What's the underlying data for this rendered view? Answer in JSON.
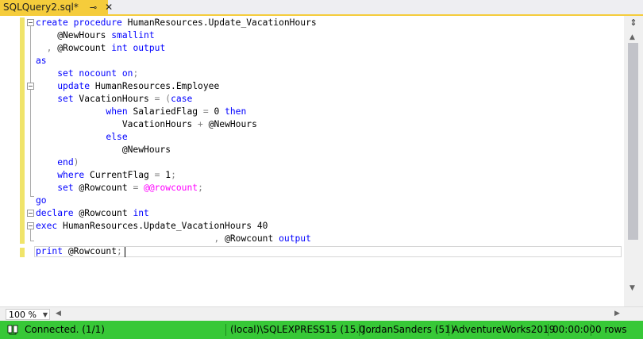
{
  "tab": {
    "title": "SQLQuery2.sql*",
    "pin": "⊸",
    "close": "✕"
  },
  "code_lines": [
    [
      {
        "t": "create procedure",
        "c": "kw"
      },
      {
        "t": " HumanResources.Update_VacationHours",
        "c": ""
      }
    ],
    [
      {
        "t": "    @NewHours ",
        "c": ""
      },
      {
        "t": "smallint",
        "c": "kw"
      }
    ],
    [
      {
        "t": "  ",
        "c": ""
      },
      {
        "t": ",",
        "c": "gr"
      },
      {
        "t": " @Rowcount ",
        "c": ""
      },
      {
        "t": "int output",
        "c": "kw"
      }
    ],
    [
      {
        "t": "as",
        "c": "kw"
      }
    ],
    [
      {
        "t": "    ",
        "c": ""
      },
      {
        "t": "set nocount on",
        "c": "kw"
      },
      {
        "t": ";",
        "c": "gr"
      }
    ],
    [
      {
        "t": "    ",
        "c": ""
      },
      {
        "t": "update",
        "c": "kw"
      },
      {
        "t": " HumanResources.Employee",
        "c": ""
      }
    ],
    [
      {
        "t": "    ",
        "c": ""
      },
      {
        "t": "set",
        "c": "kw"
      },
      {
        "t": " VacationHours ",
        "c": ""
      },
      {
        "t": "=",
        "c": "gr"
      },
      {
        "t": " ",
        "c": ""
      },
      {
        "t": "(",
        "c": "gr"
      },
      {
        "t": "case",
        "c": "kw"
      }
    ],
    [
      {
        "t": "             ",
        "c": ""
      },
      {
        "t": "when",
        "c": "kw"
      },
      {
        "t": " SalariedFlag ",
        "c": ""
      },
      {
        "t": "=",
        "c": "gr"
      },
      {
        "t": " 0 ",
        "c": ""
      },
      {
        "t": "then",
        "c": "kw"
      }
    ],
    [
      {
        "t": "                VacationHours ",
        "c": ""
      },
      {
        "t": "+",
        "c": "gr"
      },
      {
        "t": " @NewHours",
        "c": ""
      }
    ],
    [
      {
        "t": "             ",
        "c": ""
      },
      {
        "t": "else",
        "c": "kw"
      }
    ],
    [
      {
        "t": "                @NewHours",
        "c": ""
      }
    ],
    [
      {
        "t": "    ",
        "c": ""
      },
      {
        "t": "end",
        "c": "kw"
      },
      {
        "t": ")",
        "c": "gr"
      }
    ],
    [
      {
        "t": "    ",
        "c": ""
      },
      {
        "t": "where",
        "c": "kw"
      },
      {
        "t": " CurrentFlag ",
        "c": ""
      },
      {
        "t": "=",
        "c": "gr"
      },
      {
        "t": " 1",
        "c": ""
      },
      {
        "t": ";",
        "c": "gr"
      }
    ],
    [
      {
        "t": "    ",
        "c": ""
      },
      {
        "t": "set",
        "c": "kw"
      },
      {
        "t": " @Rowcount ",
        "c": ""
      },
      {
        "t": "=",
        "c": "gr"
      },
      {
        "t": " ",
        "c": ""
      },
      {
        "t": "@@rowcount",
        "c": "mg"
      },
      {
        "t": ";",
        "c": "gr"
      }
    ],
    [
      {
        "t": "go",
        "c": "kw"
      }
    ],
    [
      {
        "t": "declare",
        "c": "kw"
      },
      {
        "t": " @Rowcount ",
        "c": ""
      },
      {
        "t": "int",
        "c": "kw"
      }
    ],
    [
      {
        "t": "exec",
        "c": "kw"
      },
      {
        "t": " HumanResources.Update_VacationHours 40",
        "c": ""
      }
    ],
    [
      {
        "t": "                                 ",
        "c": ""
      },
      {
        "t": ",",
        "c": "gr"
      },
      {
        "t": " @Rowcount ",
        "c": ""
      },
      {
        "t": "output",
        "c": "kw"
      }
    ],
    [
      {
        "t": "print",
        "c": "kw"
      },
      {
        "t": " @Rowcount",
        "c": ""
      },
      {
        "t": ";",
        "c": "gr"
      }
    ]
  ],
  "zoom": {
    "value": "100 %"
  },
  "status": {
    "connection": "Connected. (1/1)",
    "server": "(local)\\SQLEXPRESS15 (15.0 ...",
    "user": "JordanSanders (51)",
    "database": "AdventureWorks2019",
    "time": "00:00:00",
    "rows": "0 rows"
  },
  "colors": {
    "keyword": "#0000ff",
    "operator": "#808080",
    "system_var": "#ff00ff",
    "status_bg": "#37c837",
    "tab_bg": "#f5cc3b"
  }
}
